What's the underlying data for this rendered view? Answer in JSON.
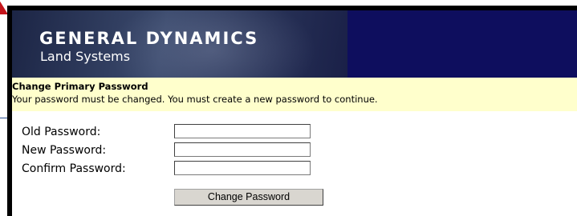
{
  "banner": {
    "company": "GENERAL DYNAMICS",
    "division": "Land Systems"
  },
  "notice": {
    "title": "Change Primary Password",
    "message": "Your password must be changed. You must create a new password to continue."
  },
  "form": {
    "old_password_label": "Old Password:",
    "new_password_label": "New Password:",
    "confirm_password_label": "Confirm Password:",
    "old_password_value": "",
    "new_password_value": "",
    "confirm_password_value": "",
    "submit_label": "Change Password"
  },
  "colors": {
    "banner_background": "#0e0e5e",
    "notice_background": "#ffffcc",
    "corner_arrow": "#c4141b"
  }
}
